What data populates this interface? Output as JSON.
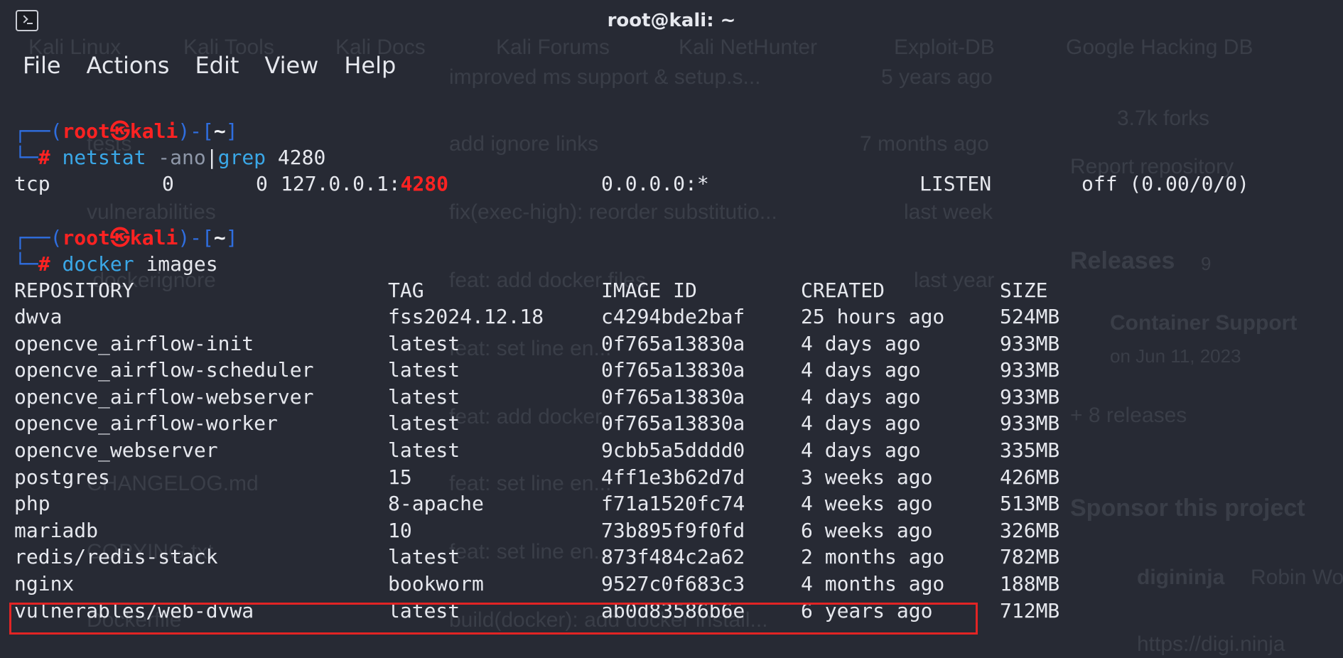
{
  "window": {
    "title": "root@kali: ~"
  },
  "menu": [
    "File",
    "Actions",
    "Edit",
    "View",
    "Help"
  ],
  "prompt": {
    "open": "┌──(",
    "user": "root",
    "skull": "㉿",
    "host": "kali",
    "close": ")-[",
    "dir": "~",
    "end": "]",
    "hash_prefix": "└─",
    "hash": "#"
  },
  "commands": {
    "netstat": {
      "cmd": "netstat",
      "args": " -ano",
      "pipe": "|",
      "grep": "grep",
      "grep_arg": " 4280"
    },
    "docker": {
      "cmd": "docker",
      "args": " images"
    }
  },
  "netstat_row": {
    "proto": "tcp",
    "recvq": "0",
    "sendq": "0",
    "local_pre": "127.0.0.1:",
    "local_port": "4280",
    "foreign": "0.0.0.0:*",
    "state": "LISTEN",
    "timer": "off (0.00/0/0)"
  },
  "images_table": {
    "headers": [
      "REPOSITORY",
      "TAG",
      "IMAGE ID",
      "CREATED",
      "SIZE"
    ],
    "rows": [
      [
        "dwva",
        "fss2024.12.18",
        "c4294bde2baf",
        "25 hours ago",
        "524MB"
      ],
      [
        "opencve_airflow-init",
        "latest",
        "0f765a13830a",
        "4 days ago",
        "933MB"
      ],
      [
        "opencve_airflow-scheduler",
        "latest",
        "0f765a13830a",
        "4 days ago",
        "933MB"
      ],
      [
        "opencve_airflow-webserver",
        "latest",
        "0f765a13830a",
        "4 days ago",
        "933MB"
      ],
      [
        "opencve_airflow-worker",
        "latest",
        "0f765a13830a",
        "4 days ago",
        "933MB"
      ],
      [
        "opencve_webserver",
        "latest",
        "9cbb5a5dddd0",
        "4 days ago",
        "335MB"
      ],
      [
        "postgres",
        "15",
        "4ff1e3b62d7d",
        "3 weeks ago",
        "426MB"
      ],
      [
        "php",
        "8-apache",
        "f71a1520fc74",
        "4 weeks ago",
        "513MB"
      ],
      [
        "mariadb",
        "10",
        "73b895f9f0fd",
        "6 weeks ago",
        "326MB"
      ],
      [
        "redis/redis-stack",
        "latest",
        "873f484c2a62",
        "2 months ago",
        "782MB"
      ],
      [
        "nginx",
        "bookworm",
        "9527c0f683c3",
        "4 months ago",
        "188MB"
      ],
      [
        "vulnerables/web-dvwa",
        "latest",
        "ab0d83586b6e",
        "6 years ago",
        "712MB"
      ]
    ],
    "highlighted_row": "vulnerables/web-dvwa"
  },
  "background": {
    "bookmarks": [
      "Kali Linux",
      "Kali Tools",
      "Kali Docs",
      "Kali Forums",
      "Kali NetHunter",
      "Exploit-DB",
      "Google Hacking DB"
    ],
    "left": [
      "tests",
      "vulnerabilities",
      ".dockerignore",
      "CHANGELOG.md",
      "COPYING.txt",
      "Dockerfile"
    ],
    "middle": [
      "improved ms support & setup.s...",
      "add ignore links",
      "fix(exec-high): reorder substitutio...",
      "feat: add docker files",
      "feat: set line en...",
      "feat: add docker...",
      "feat: set line en...",
      "feat: set line en...",
      "build(docker): add docker install..."
    ],
    "middle_dates": [
      "5 years ago",
      "7 months ago",
      "last week",
      "last year"
    ],
    "right": [
      "3.7k forks",
      "Report repository",
      "Releases",
      "9",
      "Container Support",
      "on Jun 11, 2023",
      "+ 8 releases",
      "Sponsor this project",
      "digininja",
      "Robin Wo",
      "https://digi.ninja"
    ]
  },
  "colors": {
    "prompt_frame": "#2f6ee0",
    "prompt_user": "#ff2222",
    "command": "#3aa8e8",
    "highlight_box": "#e22424"
  }
}
